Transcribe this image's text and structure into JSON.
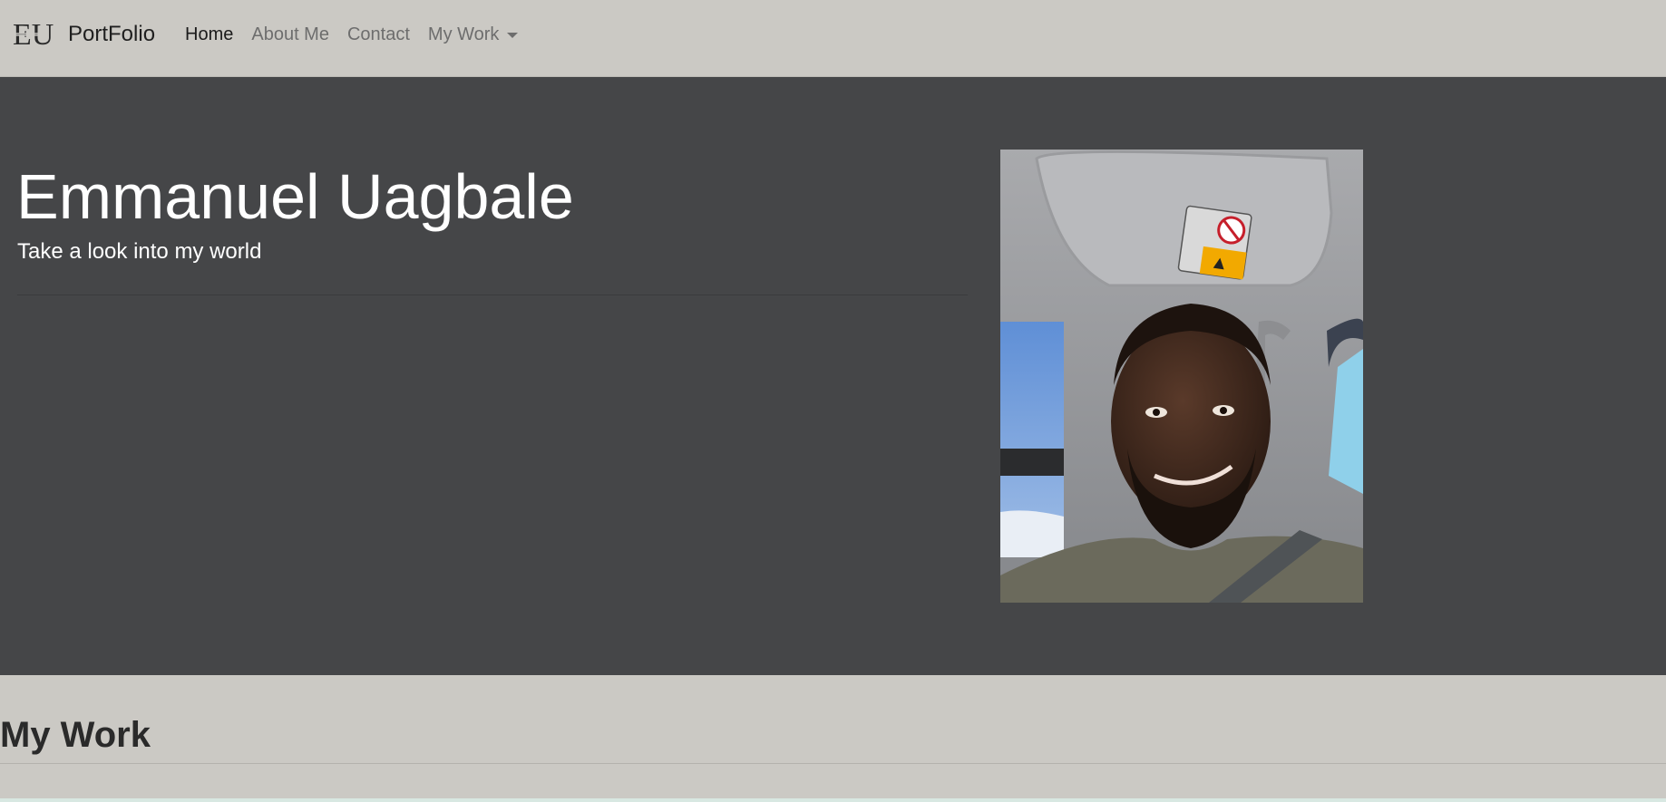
{
  "navbar": {
    "logo_text": "EU",
    "brand": "PortFolio",
    "links": [
      {
        "label": "Home",
        "active": true
      },
      {
        "label": "About Me",
        "active": false
      },
      {
        "label": "Contact",
        "active": false
      },
      {
        "label": "My Work",
        "active": false,
        "dropdown": true
      }
    ]
  },
  "hero": {
    "title": "Emmanuel Uagbale",
    "subtitle": "Take a look into my world",
    "photo_subject": "selfie of a smiling bearded man inside a car"
  },
  "section": {
    "title": "My Work"
  },
  "colors": {
    "navbar_bg": "#cbc9c4",
    "hero_bg": "#454648",
    "page_bg": "#cbc9c4",
    "text_dark": "#1f1f1f",
    "nav_inactive": "#6d6d6d",
    "hero_text": "#ffffff",
    "airbag_label": "#f2a900"
  }
}
